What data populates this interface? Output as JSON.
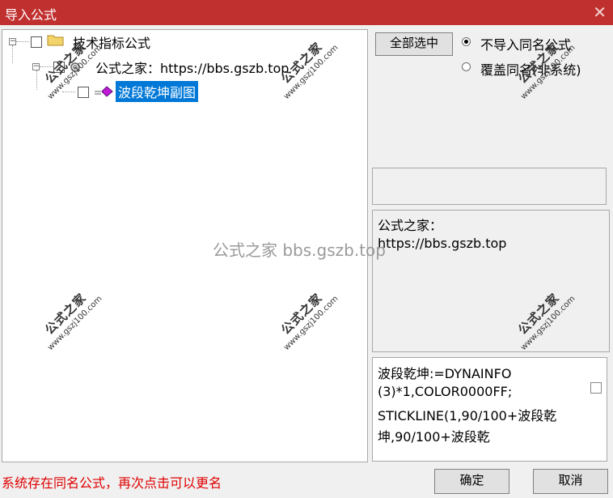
{
  "window": {
    "title": "导入公式"
  },
  "tree": {
    "root_label": "技术指标公式",
    "source_label": "公式之家：https://bbs.gszb.top",
    "item_label": "波段乾坤副图"
  },
  "controls": {
    "select_all": "全部选中",
    "radio_no_import": "不导入同名公式",
    "radio_overwrite": "覆盖同名(非系统)"
  },
  "source_text": [
    "公式之家：",
    "https://bbs.gszb.top"
  ],
  "code_lines": [
    "波段乾坤:=DYNAINFO",
    "(3)*1,COLOR0000FF;",
    "STICKLINE(1,90/100+波段乾",
    "坤,90/100+波段乾"
  ],
  "status": "系统存在同名公式，再次点击可以更名",
  "buttons": {
    "ok": "确定",
    "cancel": "取消"
  },
  "watermark": {
    "big": "公式之家",
    "small": "www.gszj100.com",
    "center": "公式之家 bbs.gszb.top"
  },
  "colors": {
    "titlebar": "#c0302f",
    "selection": "#0078d7",
    "status": "#e00000"
  }
}
